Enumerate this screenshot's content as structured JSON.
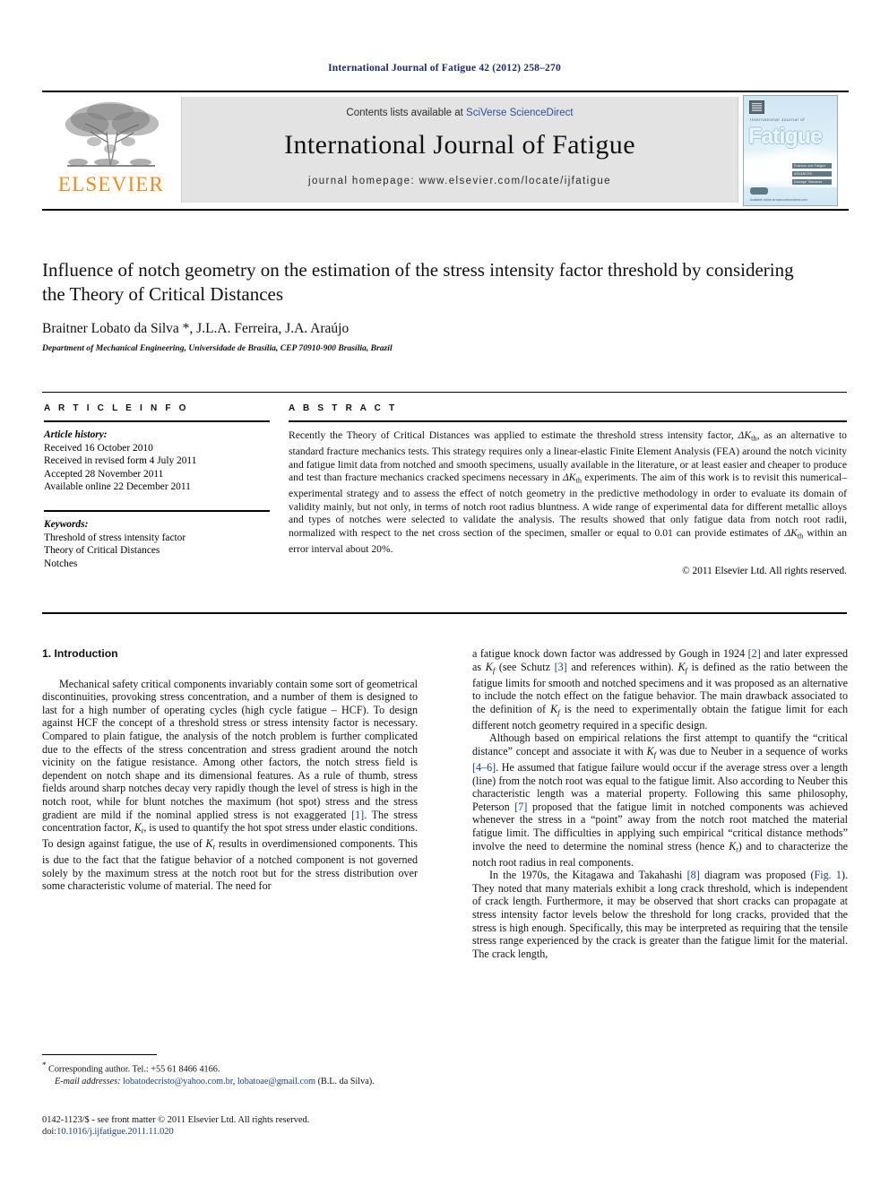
{
  "running_head": "International Journal of Fatigue 42 (2012) 258–270",
  "masthead": {
    "publisher_name": "ELSEVIER",
    "contents_prefix": "Contents lists available at ",
    "contents_link": "SciVerse ScienceDirect",
    "journal_name": "International Journal of Fatigue",
    "homepage_line": "journal homepage: www.elsevier.com/locate/ijfatigue",
    "cover": {
      "small_title": "International Journal of",
      "big_title": "Fatigue",
      "bar1": "Fracture and Fatigue",
      "bar2": "ADVANCES",
      "bar3": "Damage Tolerance",
      "footer_text": "Available online at www.sciencedirect.com"
    }
  },
  "article": {
    "title": "Influence of notch geometry on the estimation of the stress intensity factor threshold by considering the Theory of Critical Distances",
    "authors": "Braitner Lobato da Silva *, J.L.A. Ferreira, J.A. Araújo",
    "affiliation": "Department of Mechanical Engineering, Universidade de Brasília, CEP 70910-900 Brasília, Brazil"
  },
  "info": {
    "heading": "A R T I C L E   I N F O",
    "history_label": "Article history:",
    "history": [
      "Received 16 October 2010",
      "Received in revised form 4 July 2011",
      "Accepted 28 November 2011",
      "Available online 22 December 2011"
    ],
    "keywords_label": "Keywords:",
    "keywords": [
      "Threshold of stress intensity factor",
      "Theory of Critical Distances",
      "Notches"
    ]
  },
  "abstract": {
    "heading": "A B S T R A C T",
    "paragraph_1": "Recently the Theory of Critical Distances was applied to estimate the threshold stress intensity factor, ",
    "dk_symbol": "ΔK",
    "dk_sub": "th",
    "paragraph_2": ", as an alternative to standard fracture mechanics tests. This strategy requires only a linear-elastic Finite Element Analysis (FEA) around the notch vicinity and fatigue limit data from notched and smooth specimens, usually available in the literature, or at least easier and cheaper to produce and test than fracture mechanics cracked specimens necessary in ",
    "paragraph_3": " experiments. The aim of this work is to revisit this numerical–experimental strategy and to assess the effect of notch geometry in the predictive methodology in order to evaluate its domain of validity mainly, but not only, in terms of notch root radius bluntness. A wide range of experimental data for different metallic alloys and types of notches were selected to validate the analysis. The results showed that only fatigue data from notch root radii, normalized with respect to the net cross section of the specimen, smaller or equal to 0.01 can provide estimates of ",
    "paragraph_4": " within an error interval about 20%.",
    "copyright": "© 2011 Elsevier Ltd. All rights reserved."
  },
  "body": {
    "section_heading": "1. Introduction",
    "left_p1_a": "Mechanical safety critical components invariably contain some sort of geometrical discontinuities, provoking stress concentration, and a number of them is designed to last for a high number of operating cycles (high cycle fatigue – HCF). To design against HCF the concept of a threshold stress or stress intensity factor is necessary. Compared to plain fatigue, the analysis of the notch problem is further complicated due to the effects of the stress concentration and stress gradient around the notch vicinity on the fatigue resistance. Among other factors, the notch stress field is dependent on notch shape and its dimensional features. As a rule of thumb, stress fields around sharp notches decay very rapidly though the level of stress is high in the notch root, while for blunt notches the maximum (hot spot) stress and the stress gradient are mild if the nominal applied stress is not exaggerated ",
    "ref1": "[1]",
    "left_p1_b": ". The stress concentration factor, ",
    "kt": "K",
    "kt_sub": "t",
    "left_p1_c": ", is used to quantify the hot spot stress under elastic conditions. To design against fatigue, the use of ",
    "left_p1_d": " results in overdimensioned components. This is due to the fact that the fatigue behavior of a notched component is not governed solely by the maximum stress at the notch root but for the stress distribution over some characteristic volume of material. The need for",
    "right_p1_a": "a fatigue knock down factor was addressed by Gough in 1924 ",
    "ref2": "[2]",
    "right_p1_b": " and later expressed as ",
    "kf": "K",
    "kf_sub": "f",
    "right_p1_c": " (see Schutz ",
    "ref3": "[3]",
    "right_p1_d": " and references within). ",
    "right_p1_e": " is defined as the ratio between the fatigue limits for smooth and notched specimens and it was proposed as an alternative to include the notch effect on the fatigue behavior. The main drawback associated to the definition of ",
    "right_p1_f": " is the need to experimentally obtain the fatigue limit for each different notch geometry required in a specific design.",
    "right_p2_a": "Although based on empirical relations the first attempt to quantify the “critical distance” concept and associate it with ",
    "right_p2_b": " was due to Neuber in a sequence of works ",
    "ref46": "[4–6]",
    "right_p2_c": ". He assumed that fatigue failure would occur if the average stress over a length (line) from the notch root was equal to the fatigue limit. Also according to Neuber this characteristic length was a material property. Following this same philosophy, Peterson ",
    "ref7": "[7]",
    "right_p2_d": " proposed that the fatigue limit in notched components was achieved whenever the stress in a “point” away from the notch root matched the material fatigue limit. The difficulties in applying such empirical “critical distance methods” involve the need to determine the nominal stress (hence ",
    "right_p2_e": ") and to characterize the notch root radius in real components.",
    "right_p3_a": "In the 1970s, the Kitagawa and Takahashi ",
    "ref8": "[8]",
    "right_p3_b": " diagram was proposed (",
    "fig1": "Fig. 1",
    "right_p3_c": "). They noted that many materials exhibit a long crack threshold, which is independent of crack length. Furthermore, it may be observed that short cracks can propagate at stress intensity factor levels below the threshold for long cracks, provided that the stress is high enough. Specifically, this may be interpreted as requiring that the tensile stress range experienced by the crack is greater than the fatigue limit for the material. The crack length,"
  },
  "footnote": {
    "corresponding": "Corresponding author. Tel.: +55 61 8466 4166.",
    "email_label": "E-mail addresses:",
    "email_1": "lobatodecristo@yahoo.com.br",
    "email_sep": ", ",
    "email_2": "lobatoae@gmail.com",
    "email_suffix": " (B.L. da Silva)."
  },
  "imprint": {
    "issn_line": "0142-1123/$ - see front matter © 2011 Elsevier Ltd. All rights reserved.",
    "doi_label": "doi:",
    "doi_value": "10.1016/j.ijfatigue.2011.11.020"
  },
  "colors": {
    "link_blue": "#1b3a8c",
    "running_head_blue": "#1b2a6b",
    "elsevier_orange": "#f08b1d",
    "band_gray": "#e3e3e3"
  }
}
